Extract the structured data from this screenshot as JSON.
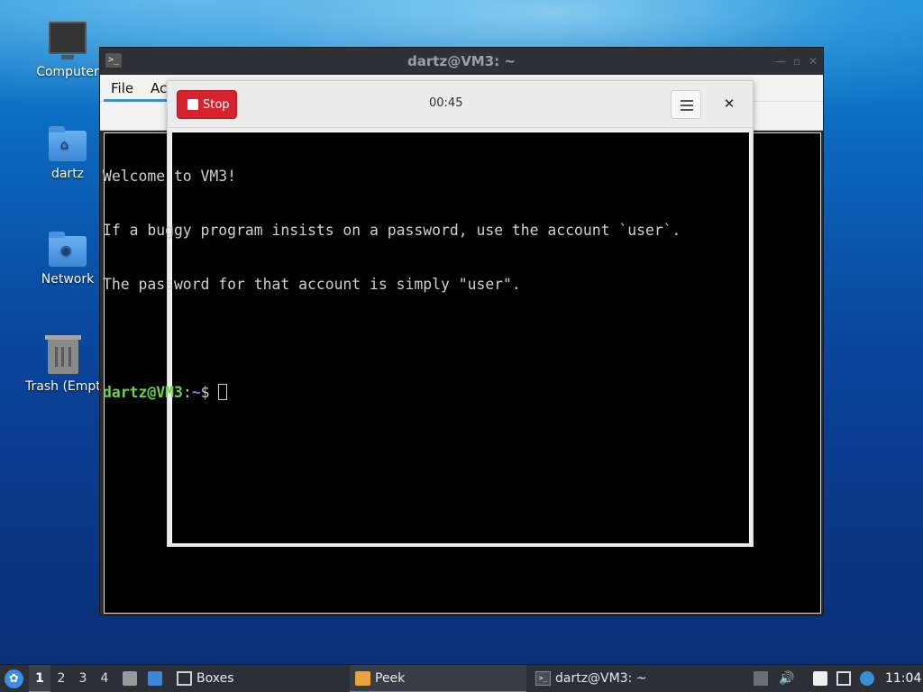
{
  "desktop": {
    "icons": [
      {
        "label": "Computer",
        "icon": "computer-icon"
      },
      {
        "label": "dartz",
        "icon": "home-folder-icon"
      },
      {
        "label": "Network",
        "icon": "network-folder-icon"
      },
      {
        "label": "Trash (Empt",
        "icon": "trash-icon"
      }
    ]
  },
  "terminal": {
    "title": "dartz@VM3: ~",
    "menu": [
      "File",
      "Ac"
    ],
    "lines": [
      "Welcome to VM3!",
      "If a buggy program insists on a password, use the account `user`.",
      "The password for that account is simply \"user\"."
    ],
    "prompt_user": "dartz@VM3",
    "prompt_sep": ":",
    "prompt_path": "~",
    "prompt_symbol": "$ "
  },
  "peek": {
    "stop_label": "Stop",
    "timer": "00:45",
    "menu_icon": "hamburger-menu-icon",
    "close_icon": "close-icon"
  },
  "taskbar": {
    "workspaces": [
      "1",
      "2",
      "3",
      "4"
    ],
    "active_workspace": "1",
    "tasks": [
      {
        "label": "Boxes",
        "icon": "boxes-icon"
      },
      {
        "label": "Peek",
        "icon": "peek-icon"
      },
      {
        "label": "dartz@VM3: ~",
        "icon": "terminal-icon"
      }
    ],
    "clock": "11:04"
  },
  "colors": {
    "stop_red": "#d5222d",
    "prompt_green": "#6cd24a",
    "prompt_blue": "#6f86ff",
    "accent_blue": "#3b8ed0"
  }
}
